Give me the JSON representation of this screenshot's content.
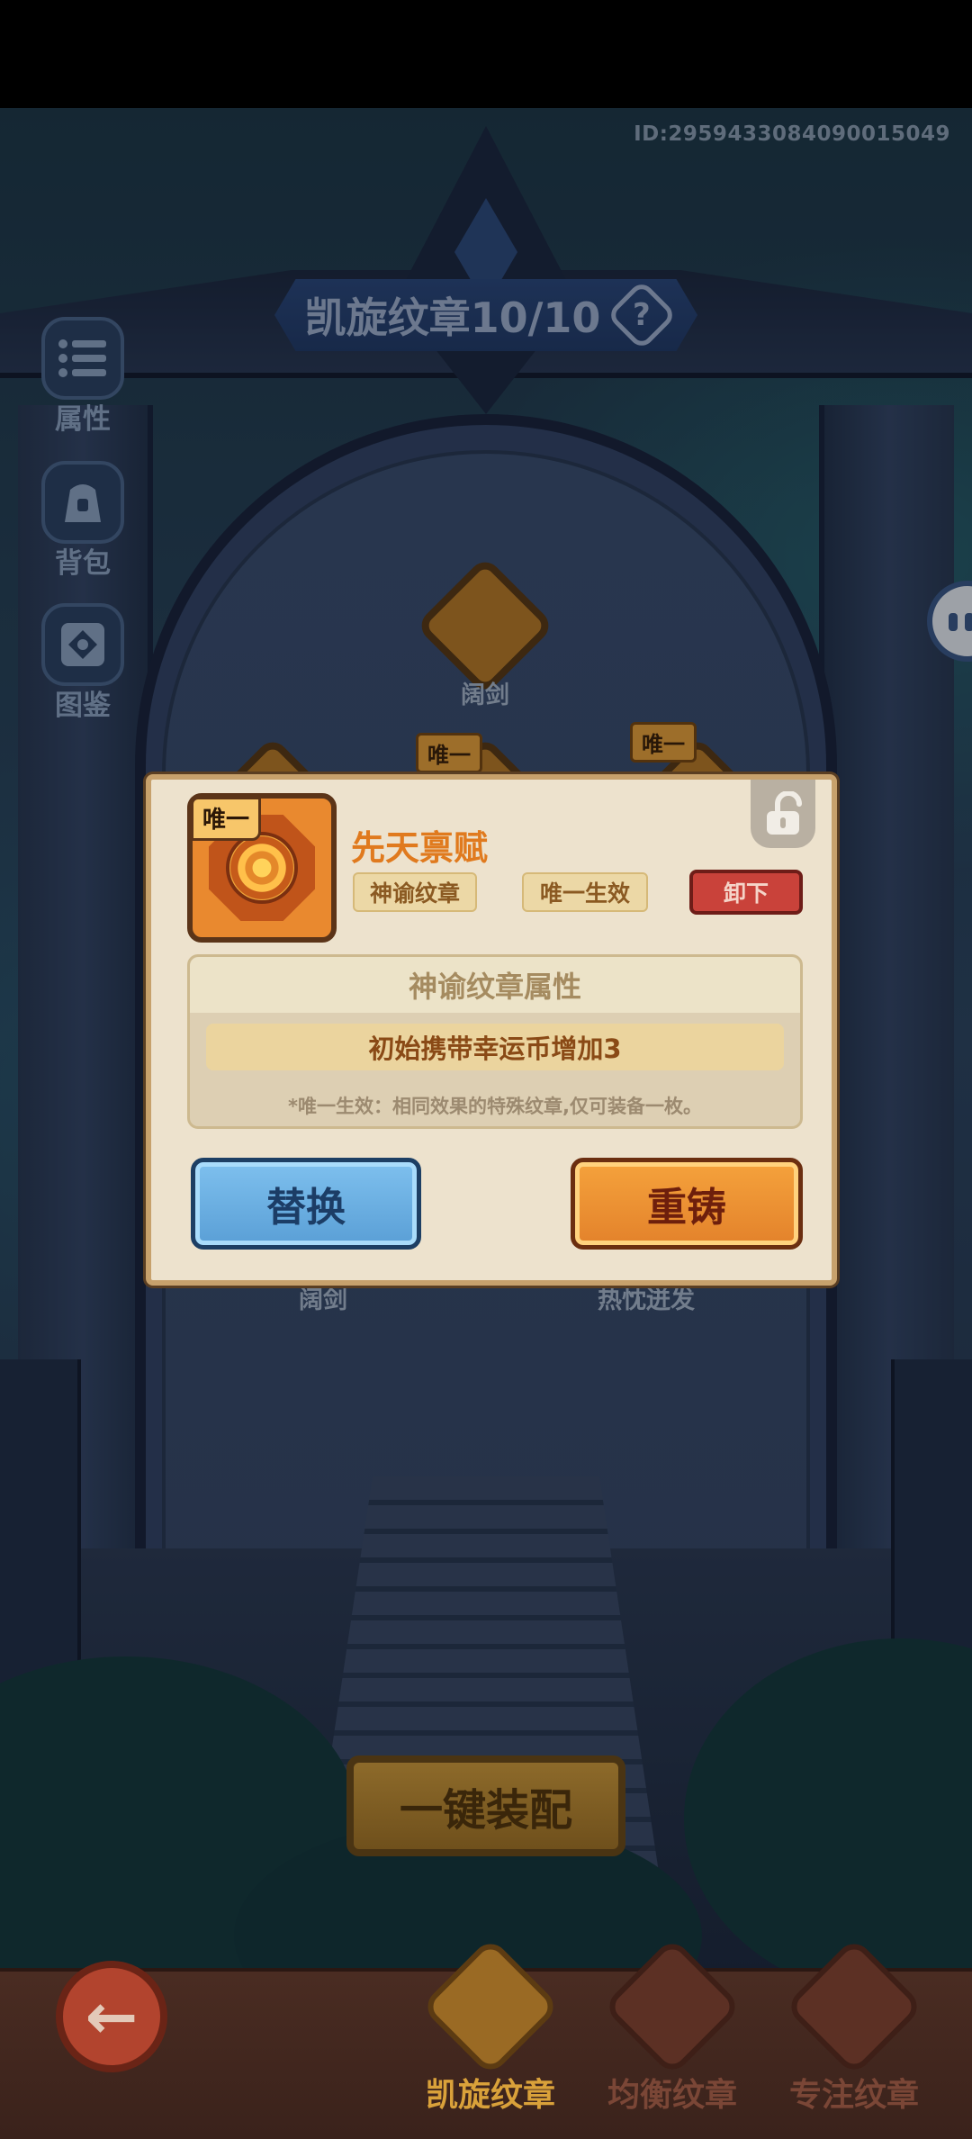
{
  "header": {
    "player_id": "ID:2959433084090015049"
  },
  "title_banner": {
    "text": "凯旋纹章10/10",
    "help_glyph": "?"
  },
  "side_menu": [
    {
      "label": "属性",
      "icon": "list-icon"
    },
    {
      "label": "背包",
      "icon": "bag-icon"
    },
    {
      "label": "图鉴",
      "icon": "codex-icon"
    }
  ],
  "slots": {
    "top_label": "阔剑",
    "left_label": "阔剑",
    "right_label": "热忱迸发",
    "tag_unique": "唯一"
  },
  "dialog": {
    "badge_tag": "唯一",
    "name": "先天禀赋",
    "chip_type": "神谕纹章",
    "chip_unique": "唯一生效",
    "unequip_label": "卸下",
    "attr_title": "神谕纹章属性",
    "attr_effect": "初始携带幸运币增加3",
    "attr_note": "*唯一生效：相同效果的特殊纹章,仅可装备一枚。",
    "replace_label": "替换",
    "recast_label": "重铸"
  },
  "equip_all_label": "一键装配",
  "bottom_tabs": [
    {
      "label": "凯旋纹章",
      "active": true
    },
    {
      "label": "均衡纹章",
      "active": false
    },
    {
      "label": "专注纹章",
      "active": false
    }
  ],
  "colors": {
    "accent_orange": "#e07a1e",
    "active_tab": "#d9a13a",
    "inactive_tab": "#7a4636"
  }
}
